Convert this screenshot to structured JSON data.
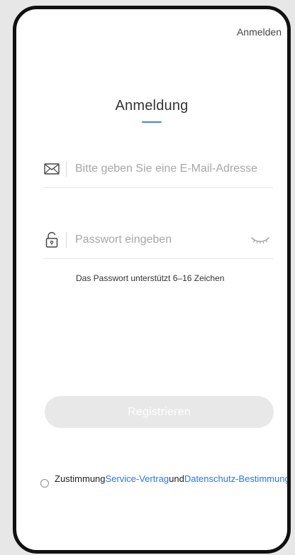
{
  "header": {
    "login_link": "Anmelden"
  },
  "page": {
    "title": "Anmeldung",
    "accent": "#3b82f6"
  },
  "form": {
    "email": {
      "value": "",
      "placeholder": "Bitte geben Sie eine E-Mail-Adresse",
      "icon": "mail-icon"
    },
    "password": {
      "value": "",
      "placeholder": "Passwort eingeben",
      "icon": "lock-icon",
      "toggle_icon": "eye-closed-icon"
    },
    "hint": "Das Passwort unterstützt 6–16 Zeichen",
    "submit_label": "Registrieren"
  },
  "consent": {
    "prefix": "Zustimmung",
    "service_link": "Service-Vertrag",
    "middle": "und",
    "privacy_link": "Datenschutz-Bestimmungen",
    "checked": false
  },
  "colors": {
    "background": "#e7e7e7",
    "link": "#2d74e8",
    "button_disabled": "#e8e8e8"
  }
}
